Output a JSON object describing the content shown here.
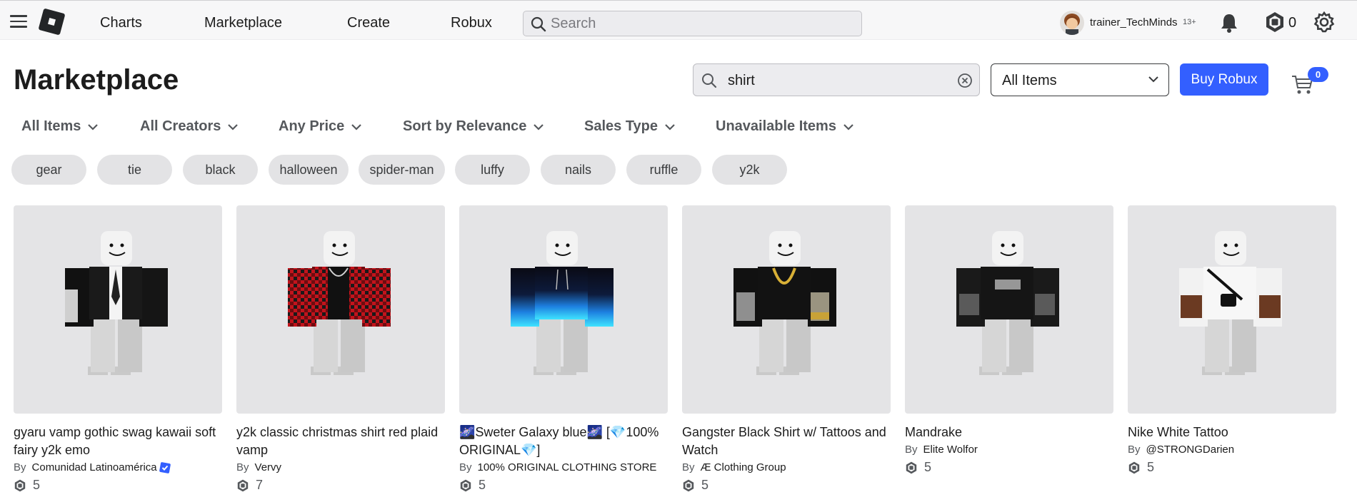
{
  "topbar": {
    "nav": [
      "Charts",
      "Marketplace",
      "Create",
      "Robux"
    ],
    "search_placeholder": "Search",
    "username": "trainer_TechMinds",
    "age_label": "13+",
    "robux_balance": "0"
  },
  "header": {
    "title": "Marketplace",
    "search_value": "shirt",
    "category_value": "All Items",
    "buy_robux_label": "Buy Robux",
    "cart_count": "0"
  },
  "filters": [
    "All Items",
    "All Creators",
    "Any Price",
    "Sort by Relevance",
    "Sales Type",
    "Unavailable Items"
  ],
  "chips": [
    "gear",
    "tie",
    "black",
    "halloween",
    "spider-man",
    "luffy",
    "nails",
    "ruffle",
    "y2k"
  ],
  "items": [
    {
      "name": "gyaru vamp gothic swag kawaii soft fairy y2k emo",
      "by": "By",
      "creator": "Comunidad Latinoamérica",
      "verified": true,
      "price": "5"
    },
    {
      "name": "y2k classic christmas shirt red plaid vamp",
      "by": "By",
      "creator": "Vervy",
      "verified": false,
      "price": "7"
    },
    {
      "name": "🌌Sweter Galaxy blue🌌 [💎100% ORIGINAL💎]",
      "by": "By",
      "creator": "100% ORIGINAL CLOTHING STORE",
      "verified": false,
      "price": "5"
    },
    {
      "name": "Gangster Black Shirt w/ Tattoos and Watch",
      "by": "By",
      "creator": "Æ Clothing Group",
      "verified": false,
      "price": "5"
    },
    {
      "name": "Mandrake",
      "by": "By",
      "creator": "Elite Wolfor",
      "verified": false,
      "price": "5"
    },
    {
      "name": "Nike White Tattoo",
      "by": "By",
      "creator": "@STRONGDarien",
      "verified": false,
      "price": "5"
    }
  ],
  "icons": {
    "menu": "hamburger-icon",
    "logo": "roblox-logo",
    "search": "search-icon",
    "clear": "clear-icon",
    "notifications": "bell-icon",
    "robux": "robux-icon",
    "settings": "gear-icon",
    "cart": "cart-icon",
    "chevron": "chevron-down-icon",
    "verified": "verified-badge-icon"
  },
  "colors": {
    "accent": "#335fff",
    "chip_bg": "#e3e3e5",
    "thumb_bg": "#e4e4e6"
  }
}
